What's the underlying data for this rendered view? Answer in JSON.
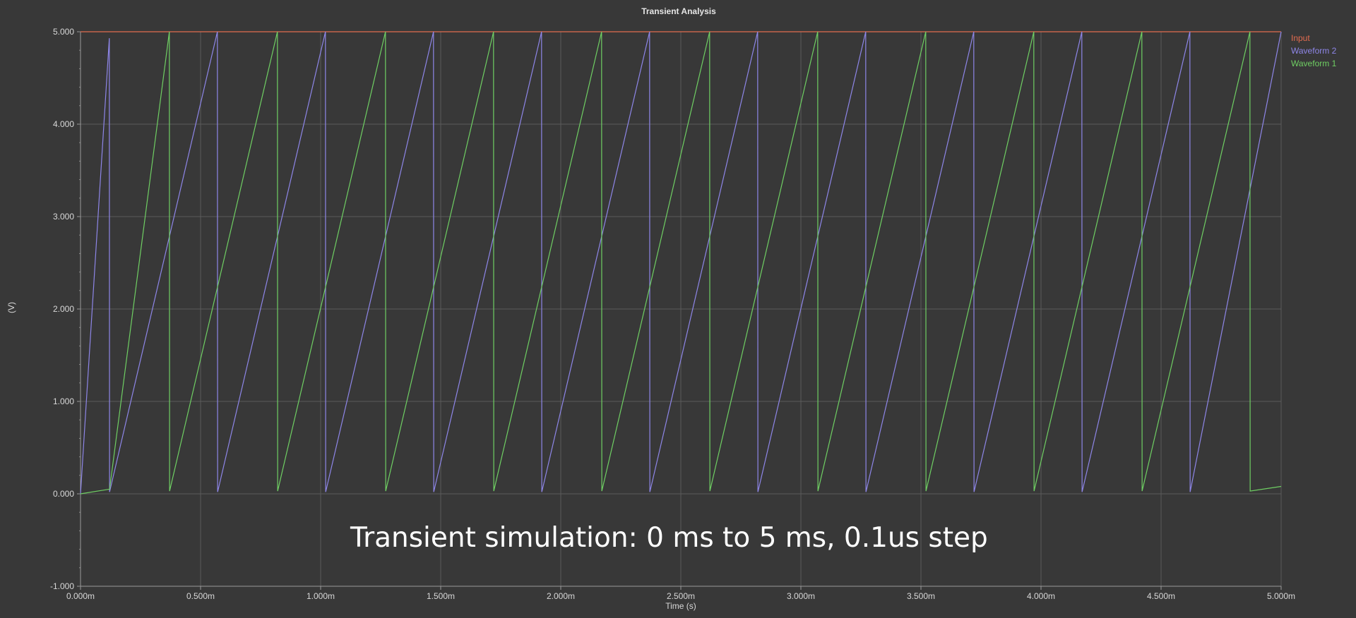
{
  "caption": "Transient simulation: 0 ms to 5 ms, 0.1us step",
  "chart_data": {
    "type": "line",
    "title": "Transient Analysis",
    "xlabel": "Time (s)",
    "ylabel": "(V)",
    "xlim": [
      0,
      0.005
    ],
    "ylim": [
      -1,
      5
    ],
    "x_ticks": [
      {
        "value": 0.0,
        "label": "0.000m"
      },
      {
        "value": 0.0005,
        "label": "0.500m"
      },
      {
        "value": 0.001,
        "label": "1.000m"
      },
      {
        "value": 0.0015,
        "label": "1.500m"
      },
      {
        "value": 0.002,
        "label": "2.000m"
      },
      {
        "value": 0.0025,
        "label": "2.500m"
      },
      {
        "value": 0.003,
        "label": "3.000m"
      },
      {
        "value": 0.0035,
        "label": "3.500m"
      },
      {
        "value": 0.004,
        "label": "4.000m"
      },
      {
        "value": 0.0045,
        "label": "4.500m"
      },
      {
        "value": 0.005,
        "label": "5.000m"
      }
    ],
    "y_ticks": [
      {
        "value": -1,
        "label": "-1.000"
      },
      {
        "value": 0,
        "label": "0.000"
      },
      {
        "value": 1,
        "label": "1.000"
      },
      {
        "value": 2,
        "label": "2.000"
      },
      {
        "value": 3,
        "label": "3.000"
      },
      {
        "value": 4,
        "label": "4.000"
      },
      {
        "value": 5,
        "label": "5.000"
      }
    ],
    "grid": true,
    "legend_position": "top-right",
    "series": [
      {
        "name": "Input",
        "color": "#e26b4f",
        "x": [
          0,
          0.005
        ],
        "y": [
          5,
          5
        ]
      },
      {
        "name": "Waveform 2",
        "color": "#8e86e8",
        "x": [
          0,
          0.00012,
          0.000121,
          0.00057,
          0.000571,
          0.00102,
          0.001021,
          0.00147,
          0.001471,
          0.00192,
          0.001921,
          0.00237,
          0.002371,
          0.00282,
          0.002821,
          0.00327,
          0.003271,
          0.00372,
          0.003721,
          0.00417,
          0.004171,
          0.00462,
          0.004621,
          0.005
        ],
        "y": [
          0,
          4.93,
          0.02,
          5.0,
          0.02,
          5.0,
          0.02,
          5.0,
          0.02,
          5.0,
          0.02,
          5.0,
          0.02,
          5.0,
          0.02,
          5.0,
          0.02,
          5.0,
          0.02,
          5.0,
          0.02,
          5.0,
          0.02,
          5.0
        ]
      },
      {
        "name": "Waveform 1",
        "color": "#6fcf63",
        "x": [
          0,
          0.00012,
          0.000121,
          0.00037,
          0.000371,
          0.00082,
          0.000821,
          0.00127,
          0.001271,
          0.00172,
          0.001721,
          0.00217,
          0.002171,
          0.00262,
          0.002621,
          0.00307,
          0.003071,
          0.00352,
          0.003521,
          0.00397,
          0.003971,
          0.00442,
          0.004421,
          0.00487,
          0.004871,
          0.005
        ],
        "y": [
          0.0,
          0.05,
          0.05,
          5.0,
          0.03,
          5.0,
          0.03,
          5.0,
          0.03,
          5.0,
          0.03,
          5.0,
          0.03,
          5.0,
          0.03,
          5.0,
          0.03,
          5.0,
          0.03,
          5.0,
          0.03,
          5.0,
          0.03,
          5.0,
          0.03,
          0.08
        ]
      }
    ]
  }
}
